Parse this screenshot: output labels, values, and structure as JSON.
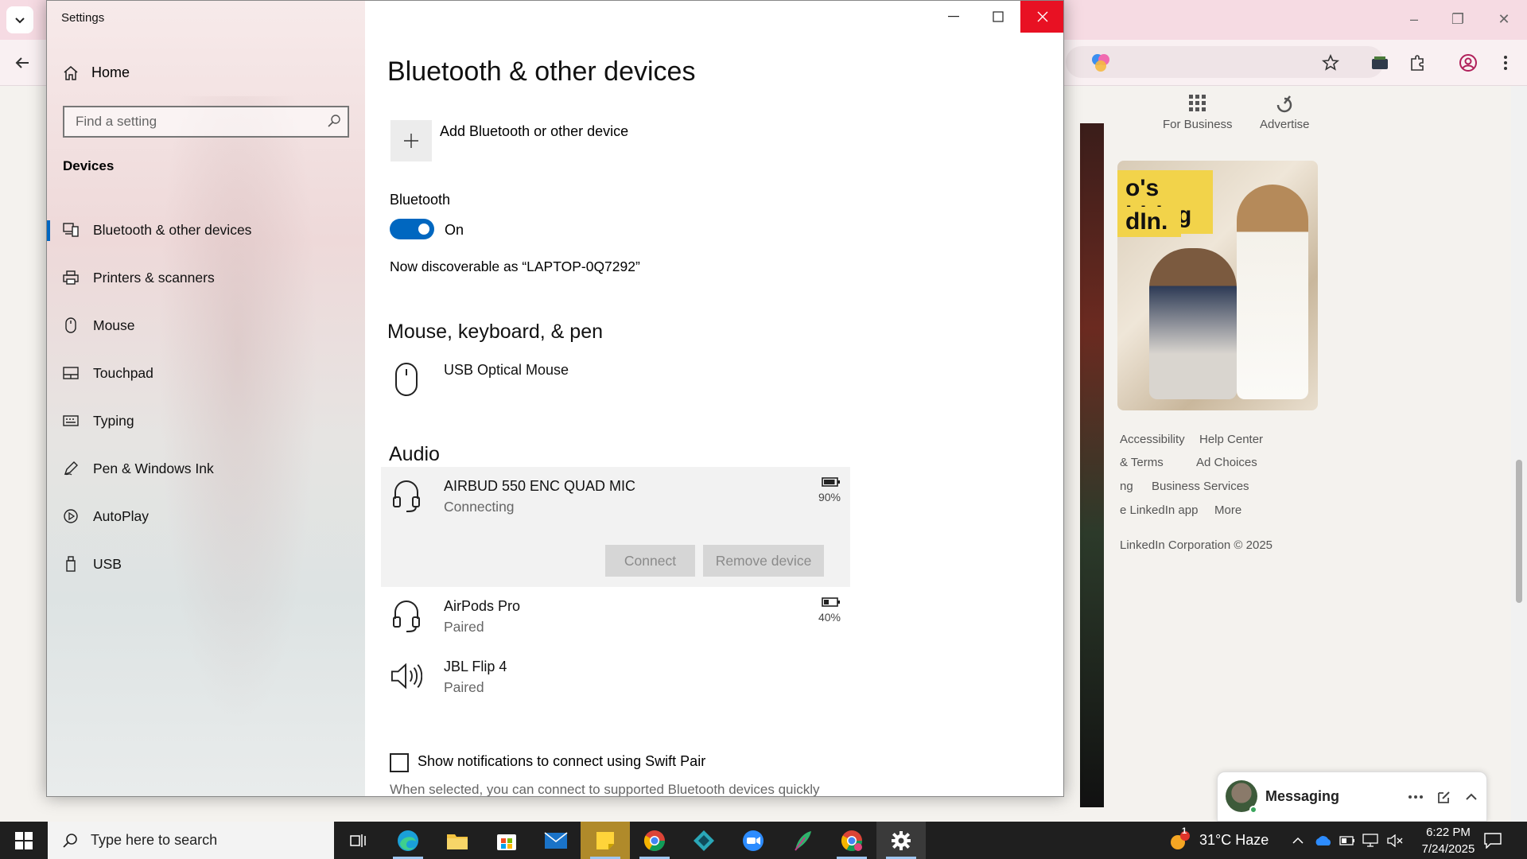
{
  "browser": {
    "nav": {
      "business": "For Business",
      "advertise": "Advertise"
    },
    "ad": {
      "line1": "o's hiring",
      "line2": "dIn."
    },
    "footer": {
      "accessibility": "Accessibility",
      "help_center": "Help Center",
      "terms": "& Terms",
      "ad_choices": "Ad Choices",
      "ng": "ng",
      "business_services": "Business Services",
      "linkedin_app": "e LinkedIn app",
      "more": "More",
      "copyright": "LinkedIn Corporation © 2025"
    },
    "messaging": {
      "title": "Messaging"
    }
  },
  "settings": {
    "window_title": "Settings",
    "home_label": "Home",
    "search_placeholder": "Find a setting",
    "section_title": "Devices",
    "nav": [
      {
        "label": "Bluetooth & other devices",
        "icon": "bluetooth-devices-icon",
        "active": true
      },
      {
        "label": "Printers & scanners",
        "icon": "printer-icon",
        "active": false
      },
      {
        "label": "Mouse",
        "icon": "mouse-icon",
        "active": false
      },
      {
        "label": "Touchpad",
        "icon": "touchpad-icon",
        "active": false
      },
      {
        "label": "Typing",
        "icon": "keyboard-icon",
        "active": false
      },
      {
        "label": "Pen & Windows Ink",
        "icon": "pen-icon",
        "active": false
      },
      {
        "label": "AutoPlay",
        "icon": "autoplay-icon",
        "active": false
      },
      {
        "label": "USB",
        "icon": "usb-icon",
        "active": false
      }
    ],
    "page_title": "Bluetooth & other devices",
    "add_device_label": "Add Bluetooth or other device",
    "bluetooth_label": "Bluetooth",
    "bluetooth_state": "On",
    "discoverable_text": "Now discoverable as “LAPTOP-0Q7292”",
    "mouse_section": {
      "title": "Mouse, keyboard, & pen",
      "devices": [
        {
          "name": "USB Optical Mouse"
        }
      ]
    },
    "audio_section": {
      "title": "Audio",
      "devices": [
        {
          "name": "AIRBUD 550 ENC QUAD MIC",
          "status": "Connecting",
          "battery": "90%",
          "battery_level": 0.9
        },
        {
          "name": "AirPods Pro",
          "status": "Paired",
          "battery": "40%",
          "battery_level": 0.4
        },
        {
          "name": "JBL Flip 4",
          "status": "Paired"
        }
      ],
      "connect_button": "Connect",
      "remove_button": "Remove device"
    },
    "swift_pair_label": "Show notifications to connect using Swift Pair",
    "swift_pair_hint": "When selected, you can connect to supported Bluetooth devices quickly",
    "accent_color": "#0067c0",
    "close_color": "#e81123"
  },
  "taskbar": {
    "search_placeholder": "Type here to search",
    "weather": "31°C Haze",
    "weather_badge": "1",
    "time": "6:22 PM",
    "date": "7/24/2025"
  }
}
